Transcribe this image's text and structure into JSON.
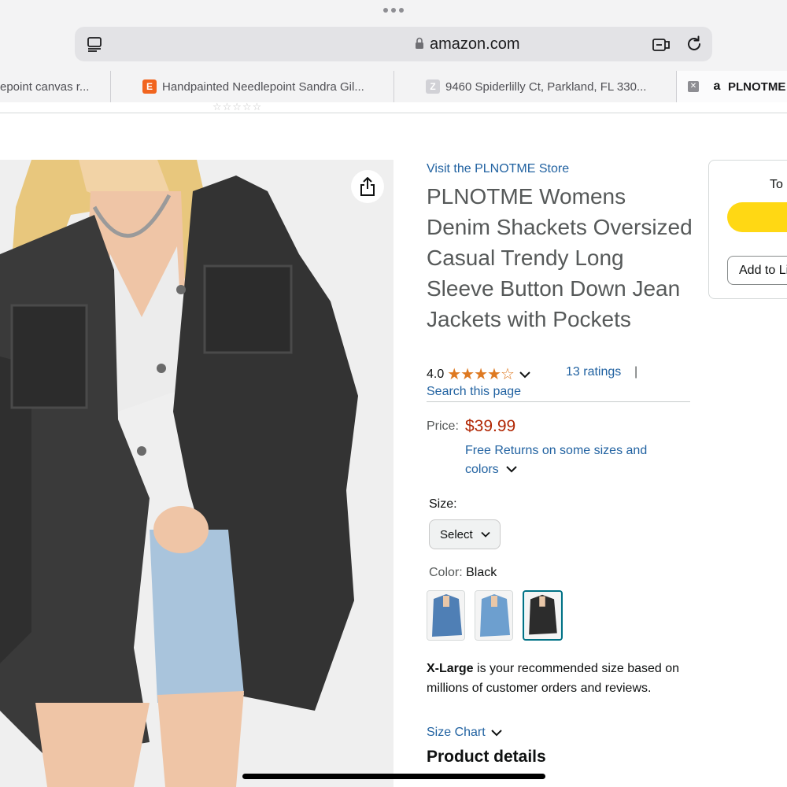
{
  "browser": {
    "host": "amazon.com",
    "tabs": [
      {
        "title": "epoint canvas r...",
        "favicon": ""
      },
      {
        "title": "Handpainted Needlepoint Sandra Gil...",
        "favicon": "E"
      },
      {
        "title": "9460 Spiderlilly Ct, Parkland, FL 330...",
        "favicon": "Z"
      },
      {
        "title": "PLNOTME",
        "favicon": "a",
        "active": true
      }
    ]
  },
  "product": {
    "store_link": "Visit the PLNOTME Store",
    "title": "PLNOTME Womens Denim Shackets Oversized Casual Trendy Long Sleeve Button Down Jean Jackets with Pockets",
    "rating_value": "4.0",
    "rating_stars": 4,
    "rating_max": 5,
    "ratings_count": "13 ratings",
    "separator": "|",
    "search_page": "Search this page",
    "price_label": "Price:",
    "price": "$39.99",
    "returns": "Free Returns on some sizes and colors",
    "size_label": "Size:",
    "size_select": "Select",
    "color_label": "Color: ",
    "color_value": "Black",
    "swatches": [
      {
        "color": "Blue"
      },
      {
        "color": "Light Blue"
      },
      {
        "color": "Black",
        "selected": true
      }
    ],
    "recommendation_size": "X-Large",
    "recommendation_text": " is your recommended size based on millions of customer orders and reviews.",
    "size_chart": "Size Chart",
    "details_heading": "Product details"
  },
  "buybox": {
    "to_label": "To",
    "add_to_list": "Add to Li"
  },
  "colors": {
    "link": "#2162a1",
    "price": "#b12704",
    "star": "#de7921",
    "buy_button": "#ffd814"
  }
}
